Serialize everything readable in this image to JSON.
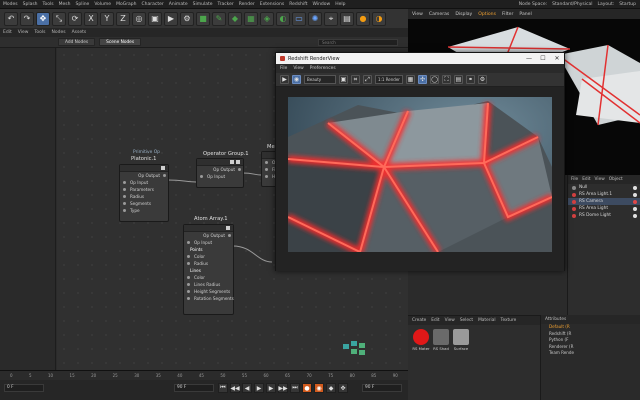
{
  "app": {
    "menu": [
      "Modes",
      "Splash",
      "Tools",
      "Mesh",
      "Spline",
      "Volume",
      "MoGraph",
      "Character",
      "Animate",
      "Simulate",
      "Tracker",
      "Render",
      "Extensions",
      "Redshift",
      "Window",
      "Help"
    ],
    "right_menu": [
      "Node Space:",
      "Standard/Physical",
      "Layout:",
      "Startup"
    ]
  },
  "toolbar": {
    "buttons": [
      {
        "icon": "undo-icon",
        "glyph": "↶"
      },
      {
        "icon": "redo-icon",
        "glyph": "↷"
      },
      {
        "icon": "move-icon",
        "glyph": "✥"
      },
      {
        "icon": "scale-icon",
        "glyph": "⤡"
      },
      {
        "icon": "rotate-icon",
        "glyph": "⟳"
      },
      {
        "icon": "x-axis-icon",
        "glyph": "X"
      },
      {
        "icon": "y-axis-icon",
        "glyph": "Y"
      },
      {
        "icon": "z-axis-icon",
        "glyph": "Z"
      },
      {
        "icon": "world-icon",
        "glyph": "◎"
      },
      {
        "icon": "render-region-icon",
        "glyph": "▣"
      },
      {
        "icon": "render-view-icon",
        "glyph": "▶"
      },
      {
        "icon": "render-settings-icon",
        "glyph": "⚙"
      },
      {
        "icon": "cube-icon",
        "glyph": "■"
      },
      {
        "icon": "pen-icon",
        "glyph": "✎"
      },
      {
        "icon": "subdivision-icon",
        "glyph": "◆"
      },
      {
        "icon": "cloner-icon",
        "glyph": "▦"
      },
      {
        "icon": "deformer-icon",
        "glyph": "◈"
      },
      {
        "icon": "environment-icon",
        "glyph": "◐"
      },
      {
        "icon": "camera-icon",
        "glyph": "▭"
      },
      {
        "icon": "light-icon",
        "glyph": "✺"
      },
      {
        "icon": "snap-icon",
        "glyph": "⌖"
      },
      {
        "icon": "workplane-icon",
        "glyph": "▤"
      },
      {
        "icon": "redshift-icon",
        "glyph": "●"
      },
      {
        "icon": "display-icon",
        "glyph": "◑"
      }
    ]
  },
  "node_editor": {
    "menu": [
      "Edit",
      "View",
      "Tools",
      "Nodes",
      "Assets"
    ],
    "tabs": [
      "Add Nodes",
      "Scene Nodes"
    ],
    "search_placeholder": "Search",
    "nodes": {
      "platonic": {
        "subtitle": "Primitive Op",
        "title": "Platonic.1",
        "output": "Op Output",
        "rows": [
          "Op Input",
          "Parameters",
          "Radius",
          "Segments",
          "Type"
        ]
      },
      "operator_group": {
        "title": "Operator Group.1",
        "output": "Op Output",
        "rows": [
          "Op Input"
        ]
      },
      "me": {
        "title": "Me",
        "rows": [
          "Op Input",
          "File Fr...",
          "Hidden..."
        ]
      },
      "atom_array": {
        "title": "Atom Array.1",
        "output": "Op Output",
        "rows": [
          "Op Input",
          "Points",
          "Color",
          "Radius",
          "Lines",
          "Color",
          "Lines Radius",
          "Height Segments",
          "Rotation Segments"
        ]
      }
    }
  },
  "timeline": {
    "ticks": [
      "0",
      "5",
      "10",
      "15",
      "20",
      "25",
      "30",
      "35",
      "40",
      "45",
      "50",
      "55",
      "60",
      "65",
      "70",
      "75",
      "80",
      "85",
      "90"
    ],
    "start_field": "0 F",
    "end_field": "90 F",
    "current_field": "90 F"
  },
  "viewport": {
    "menu": [
      "View",
      "Cameras",
      "Display",
      "Options",
      "Filter",
      "Panel"
    ],
    "active_item": "Options"
  },
  "object_manager": {
    "menu": [
      "File",
      "Edit",
      "View",
      "Object"
    ],
    "objects": [
      {
        "label": "Null",
        "dot": "grey",
        "tag": "white"
      },
      {
        "label": "RS Area Light.1",
        "dot": "red",
        "tag": "white"
      },
      {
        "label": "RS Camera",
        "dot": "red",
        "tag": "red"
      },
      {
        "label": "RS Area Light",
        "dot": "red",
        "tag": "white"
      },
      {
        "label": "RS Dome Light",
        "dot": "red",
        "tag": "white"
      }
    ]
  },
  "material_manager": {
    "menu": [
      "Create",
      "Edit",
      "View",
      "Select",
      "Material",
      "Texture"
    ],
    "materials": [
      {
        "label": "RS Mater",
        "color": "#e01818"
      },
      {
        "label": "RS Shad",
        "color": "#6a6a6a"
      },
      {
        "label": "Surface",
        "color": "#9a9a9a"
      }
    ]
  },
  "attributes": {
    "title": "Attributes",
    "rows": [
      "Default (R",
      "Redshift (R",
      "Python (F",
      "Renderer (R",
      "Team Rende"
    ]
  },
  "render_view": {
    "title": "Redshift RenderView",
    "menu": [
      "File",
      "View",
      "Preferences"
    ],
    "mode_select": "Beauty",
    "aov_select": "1:1 Render",
    "window_buttons": [
      "—",
      "☐",
      "✕"
    ],
    "tools": [
      {
        "icon": "render-start-icon",
        "glyph": "▶"
      },
      {
        "icon": "ipr-icon",
        "glyph": "◉"
      },
      {
        "icon": "snapshot-icon",
        "glyph": "▣"
      },
      {
        "icon": "crop-icon",
        "glyph": "⌗"
      },
      {
        "icon": "fit-icon",
        "glyph": "⤢"
      },
      {
        "icon": "lock-icon",
        "glyph": "▦"
      },
      {
        "icon": "pick-icon",
        "glyph": "✣"
      },
      {
        "icon": "focus-icon",
        "glyph": "◯"
      },
      {
        "icon": "expand-icon",
        "glyph": "⛶"
      },
      {
        "icon": "grid-icon",
        "glyph": "▤"
      },
      {
        "icon": "link-icon",
        "glyph": "⚭"
      },
      {
        "icon": "settings-icon",
        "glyph": "⚙"
      }
    ]
  },
  "colors": {
    "accent": "#f0a030",
    "selection": "#4a6fa5",
    "glow_red": "#ff2a2a"
  }
}
